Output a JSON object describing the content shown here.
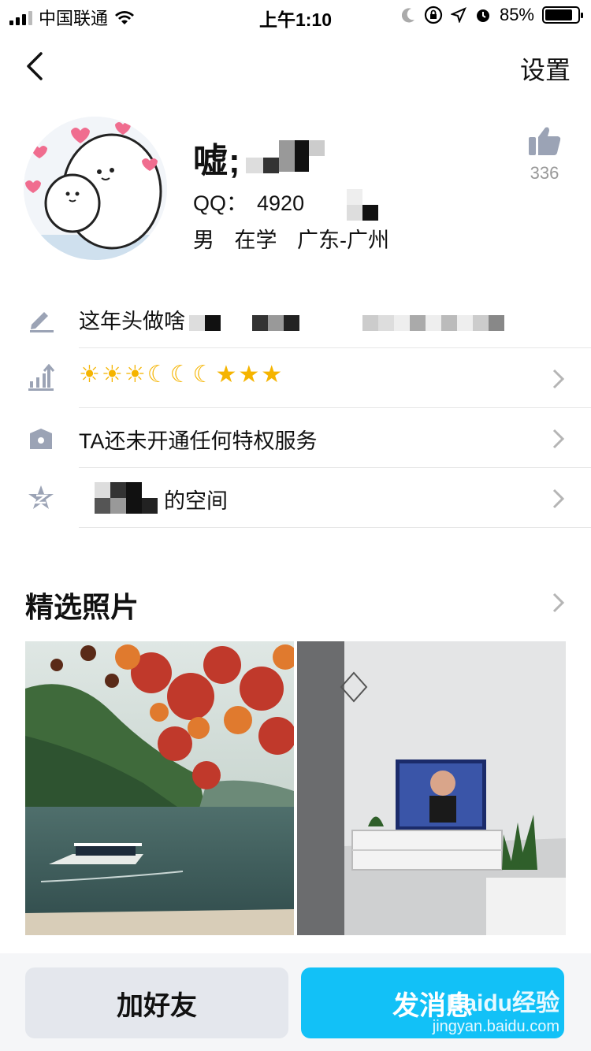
{
  "status_bar": {
    "carrier": "中国联通",
    "time": "上午1:10",
    "battery": "85%",
    "battery_level": 0.85
  },
  "nav": {
    "settings_label": "设置"
  },
  "profile": {
    "name": "嘘;",
    "qq_label": "QQ：",
    "qq_number": "4920",
    "gender": "男",
    "status": "在学",
    "location": "广东-广州",
    "like_count": "336"
  },
  "rows": {
    "signature": "这年头做啥",
    "level_icons": [
      "sun",
      "sun",
      "sun",
      "moon",
      "moon",
      "moon",
      "star",
      "star",
      "star"
    ],
    "privilege": "TA还未开通任何特权服务",
    "space": "的空间"
  },
  "photos": {
    "title": "精选照片"
  },
  "actions": {
    "add_friend": "加好友",
    "send_message": "发消息"
  },
  "watermark": {
    "logo": "Baidu经验",
    "url": "jingyan.baidu.com"
  }
}
